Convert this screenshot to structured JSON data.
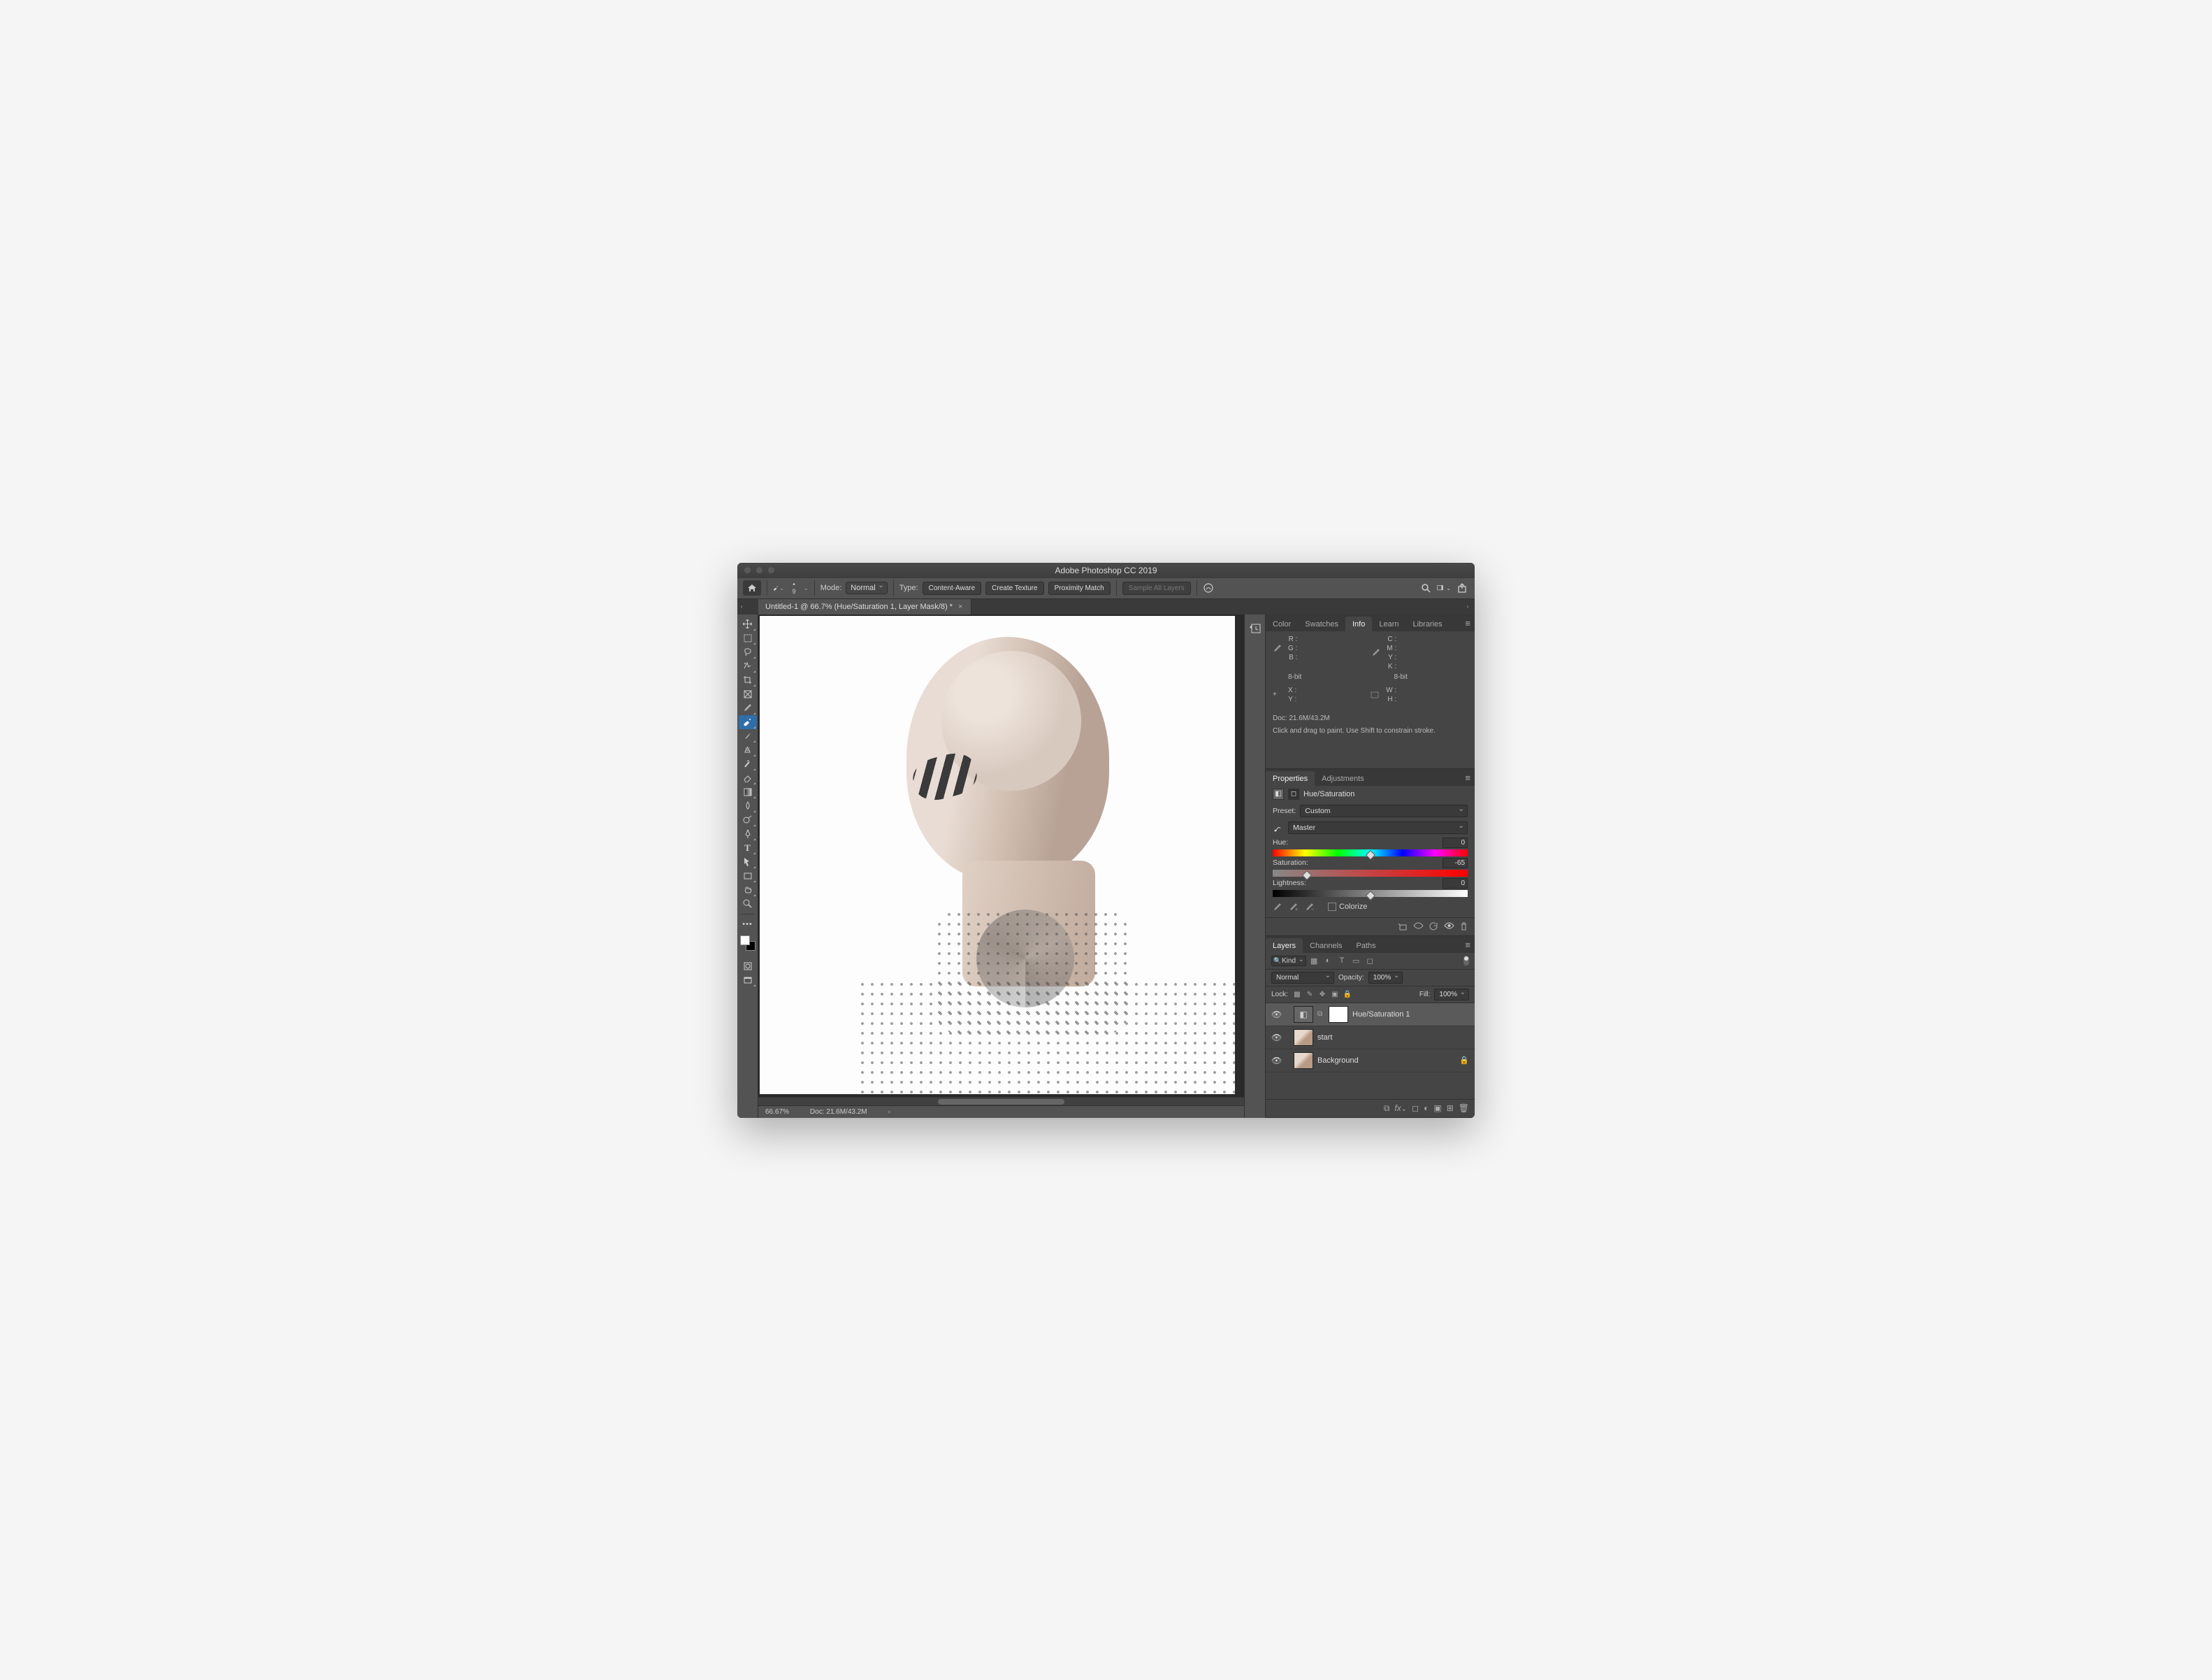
{
  "app": {
    "title": "Adobe Photoshop CC 2019"
  },
  "optionsbar": {
    "brush_size": "9",
    "mode_label": "Mode:",
    "mode_value": "Normal",
    "type_label": "Type:",
    "content_aware": "Content-Aware",
    "create_texture": "Create Texture",
    "proximity_match": "Proximity Match",
    "sample_all": "Sample All Layers"
  },
  "tab": {
    "title": "Untitled-1 @ 66.7% (Hue/Saturation 1, Layer Mask/8) *"
  },
  "status": {
    "zoom": "66.67%",
    "doc": "Doc: 21.6M/43.2M"
  },
  "info_panel": {
    "tabs": [
      "Color",
      "Swatches",
      "Info",
      "Learn",
      "Libraries"
    ],
    "active_tab_index": 2,
    "rgb": {
      "R": "R :",
      "G": "G :",
      "B": "B :"
    },
    "cmyk": {
      "C": "C :",
      "M": "M :",
      "Y": "Y :",
      "K": "K :"
    },
    "bit": "8-bit",
    "xy": {
      "X": "X :",
      "Y": "Y :"
    },
    "wh": {
      "W": "W :",
      "H": "H :"
    },
    "doc": "Doc: 21.6M/43.2M",
    "hint": "Click and drag to paint. Use Shift to constrain stroke."
  },
  "properties_panel": {
    "tabs": [
      "Properties",
      "Adjustments"
    ],
    "active_tab_index": 0,
    "adj_name": "Hue/Saturation",
    "preset_label": "Preset:",
    "preset_value": "Custom",
    "channel_value": "Master",
    "hue_label": "Hue:",
    "hue_value": "0",
    "sat_label": "Saturation:",
    "sat_value": "-65",
    "light_label": "Lightness:",
    "light_value": "0",
    "colorize_label": "Colorize"
  },
  "layers_panel": {
    "tabs": [
      "Layers",
      "Channels",
      "Paths"
    ],
    "active_tab_index": 0,
    "filter_mode": "Kind",
    "blend_mode": "Normal",
    "opacity_label": "Opacity:",
    "opacity_value": "100%",
    "lock_label": "Lock:",
    "fill_label": "Fill:",
    "fill_value": "100%",
    "layers": [
      {
        "name": "Hue/Saturation 1",
        "type": "adjustment",
        "selected": true,
        "locked": false
      },
      {
        "name": "start",
        "type": "image",
        "selected": false,
        "locked": false
      },
      {
        "name": "Background",
        "type": "image",
        "selected": false,
        "locked": true
      }
    ]
  }
}
